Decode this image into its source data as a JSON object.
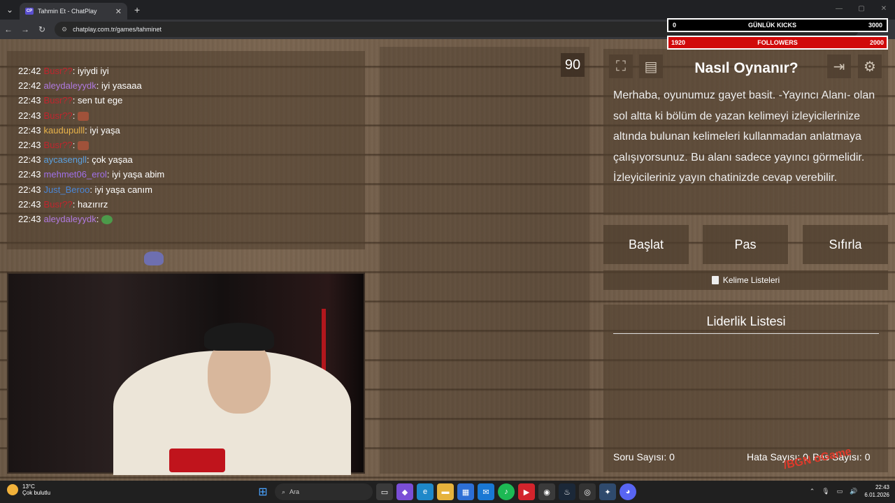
{
  "browser": {
    "tab_title": "Tahmin Et - ChatPlay",
    "tab_favicon": "CP",
    "url": "chatplay.com.tr/games/tahminet"
  },
  "overlay": {
    "kick_left": "0",
    "kick_label": "GÜNLÜK KICKS",
    "kick_right": "3000",
    "follow_left": "1920",
    "follow_label": "FOLLOWERS",
    "follow_right": "2000",
    "follow_progress": 0.96
  },
  "chat": [
    {
      "time": "22:42",
      "user": "Busr??",
      "msg": "iyiydi iyi",
      "color": "#c0252e"
    },
    {
      "time": "22:42",
      "user": "aleydaleyydk",
      "msg": "iyi yasaaa",
      "color": "#b07ae0"
    },
    {
      "time": "22:43",
      "user": "Busr??",
      "msg": "sen tut ege",
      "color": "#c0252e"
    },
    {
      "time": "22:43",
      "user": "Busr??",
      "msg": "",
      "emote": "emote",
      "color": "#c0252e"
    },
    {
      "time": "22:43",
      "user": "kaudupulll",
      "msg": "iyi yaşa",
      "color": "#e8b34a"
    },
    {
      "time": "22:43",
      "user": "Busr??",
      "msg": "",
      "emote": "emote",
      "color": "#c0252e"
    },
    {
      "time": "22:43",
      "user": "aycasengll",
      "msg": "çok yaşaa",
      "color": "#5aa0e0"
    },
    {
      "time": "22:43",
      "user": "mehmet06_erol",
      "msg": "iyi yaşa abim",
      "color": "#a070e8"
    },
    {
      "time": "22:43",
      "user": "Just_Beroo",
      "msg": "iyi yaşa canım",
      "color": "#4a86d6"
    },
    {
      "time": "22:43",
      "user": "Busr??",
      "msg": "hazırırz",
      "color": "#c0252e"
    },
    {
      "time": "22:43",
      "user": "aleydaleyydk",
      "msg": "",
      "emote": "pepe",
      "color": "#b07ae0"
    }
  ],
  "game": {
    "timer": "90",
    "how_title": "Nasıl Oynanır?",
    "how_text": "Merhaba, oyunumuz gayet basit. -Yayıncı Alanı- olan sol altta ki bölüm de yazan kelimeyi izleyicilerinize altında bulunan kelimeleri kullanmadan anlatmaya çalışıyorsunuz. Bu alanı sadece yayıncı görmelidir. İzleyicileriniz yayın chatinizde cevap verebilir.",
    "start_label": "Başlat",
    "pass_label": "Pas",
    "reset_label": "Sıfırla",
    "wordlists_label": "Kelime Listeleri",
    "leaderboard_title": "Liderlik Listesi",
    "question_count": "Soru Sayısı: 0",
    "error_count": "Hata Sayısı: 0",
    "pass_count": "Pas Sayısı: 0"
  },
  "taskbar": {
    "temp": "13°C",
    "weather": "Çok bulutlu",
    "search_placeholder": "Ara",
    "time": "22:43",
    "date": "6.01.2026"
  }
}
